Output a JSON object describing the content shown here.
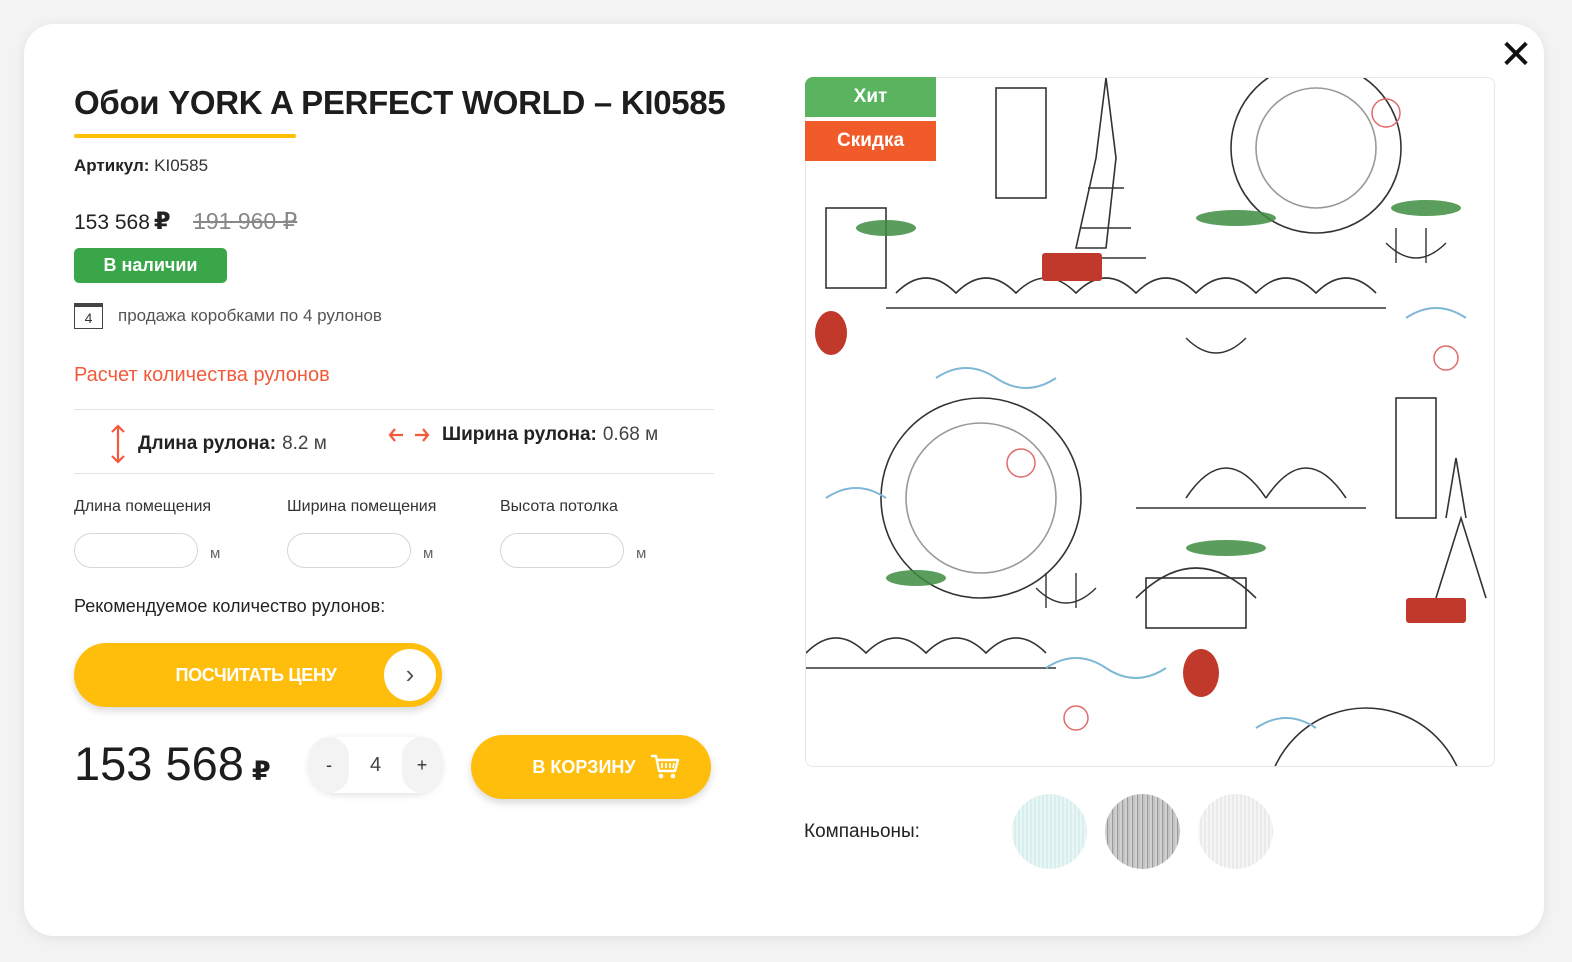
{
  "product": {
    "title": "Обои YORK A PERFECT WORLD – KI0585",
    "sku_label": "Артикул:",
    "sku_value": "KI0585",
    "price_current": "153 568",
    "price_current_currency": "₽",
    "price_old": "191 960 ₽",
    "stock_badge": "В наличии",
    "box_count": "4",
    "box_text": "продажа коробками по 4 рулонов",
    "image_alt": "Обои YORK A PERFECT WORLD – KI0585"
  },
  "calculator": {
    "link": "Расчет количества рулонов",
    "roll_length_label": "Длина рулона:",
    "roll_length_value": "8.2 м",
    "roll_width_label": "Ширина рулона:",
    "roll_width_value": "0.68 м",
    "fields": [
      {
        "label": "Длина помещения",
        "value": "",
        "unit": "м"
      },
      {
        "label": "Ширина помещения",
        "value": "",
        "unit": "м"
      },
      {
        "label": "Высота потолка",
        "value": "",
        "unit": "м"
      }
    ],
    "recommended_label": "Рекомендуемое количество рулонов:",
    "calc_button": "ПОСЧИТАТЬ ЦЕНУ"
  },
  "purchase": {
    "total_price": "153 568",
    "currency": "₽",
    "qty_minus": "-",
    "qty_value": "4",
    "qty_plus": "+",
    "cart_button": "В КОРЗИНУ"
  },
  "badges": {
    "hit": "Хит",
    "sale": "Скидка"
  },
  "companions": {
    "label": "Компаньоны:"
  },
  "colors": {
    "accent": "#ffbe0b",
    "link": "#f15a3b",
    "stock": "#3aa64a",
    "hit": "#5ab35e",
    "sale": "#f15a29"
  }
}
